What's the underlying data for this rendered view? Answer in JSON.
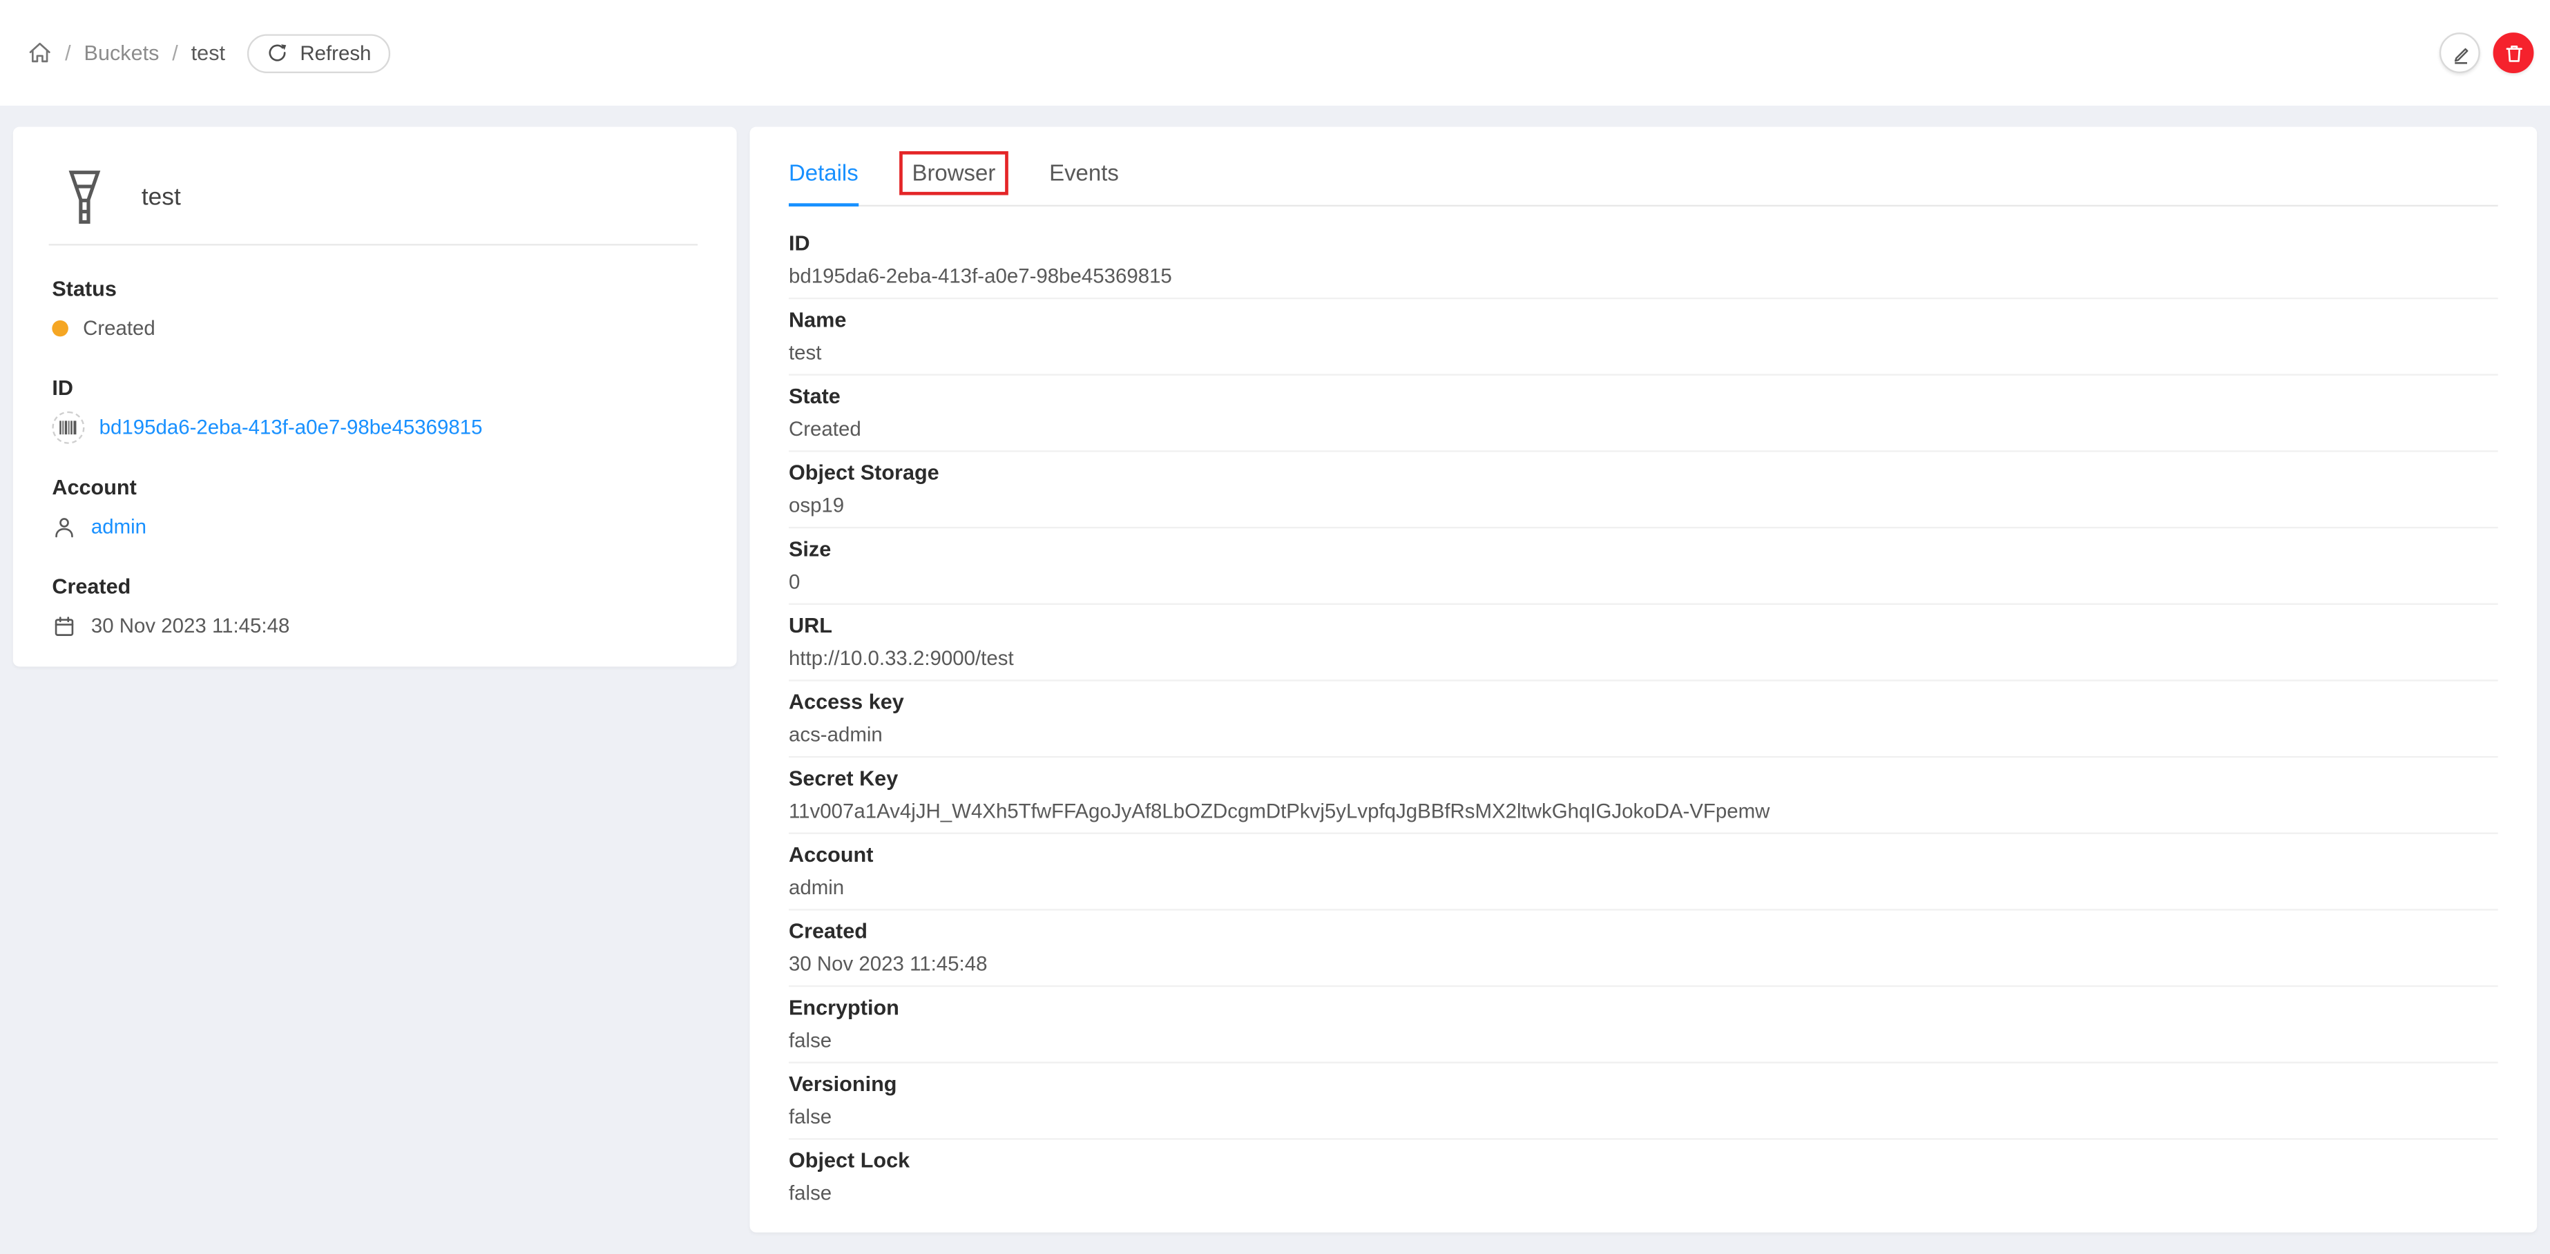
{
  "breadcrumb": {
    "separator": "/",
    "items": [
      {
        "label": "Buckets",
        "link": true
      },
      {
        "label": "test",
        "link": false
      }
    ]
  },
  "header": {
    "refresh_label": "Refresh"
  },
  "resource_card": {
    "title": "test",
    "icon": "bucket-funnel",
    "fields": [
      {
        "label": "Status",
        "value": "Created",
        "icon": "status-dot",
        "link": false
      },
      {
        "label": "ID",
        "value": "bd195da6-2eba-413f-a0e7-98be45369815",
        "icon": "barcode",
        "link": true
      },
      {
        "label": "Account",
        "value": "admin",
        "icon": "user",
        "link": true
      },
      {
        "label": "Created",
        "value": "30 Nov 2023 11:45:48",
        "icon": "calendar",
        "link": false
      }
    ]
  },
  "tabs": {
    "items": [
      "Details",
      "Browser",
      "Events"
    ],
    "active": "Details",
    "annotated": "Browser"
  },
  "details": {
    "items": [
      {
        "label": "ID",
        "value": "bd195da6-2eba-413f-a0e7-98be45369815"
      },
      {
        "label": "Name",
        "value": "test"
      },
      {
        "label": "State",
        "value": "Created"
      },
      {
        "label": "Object Storage",
        "value": "osp19"
      },
      {
        "label": "Size",
        "value": "0"
      },
      {
        "label": "URL",
        "value": "http://10.0.33.2:9000/test"
      },
      {
        "label": "Access key",
        "value": "acs-admin"
      },
      {
        "label": "Secret Key",
        "value": "11v007a1Av4jJH_W4Xh5TfwFFAgoJyAf8LbOZDcgmDtPkvj5yLvpfqJgBBfRsMX2ltwkGhqIGJokoDA-VFpemw"
      },
      {
        "label": "Account",
        "value": "admin"
      },
      {
        "label": "Created",
        "value": "30 Nov 2023 11:45:48"
      },
      {
        "label": "Encryption",
        "value": "false"
      },
      {
        "label": "Versioning",
        "value": "false"
      },
      {
        "label": "Object Lock",
        "value": "false"
      }
    ]
  },
  "colors": {
    "accent": "#1890ff",
    "status_orange": "#f5a623",
    "danger_red": "#f5222d",
    "annotation_red": "#e42527",
    "page_bg": "#eef0f5"
  }
}
